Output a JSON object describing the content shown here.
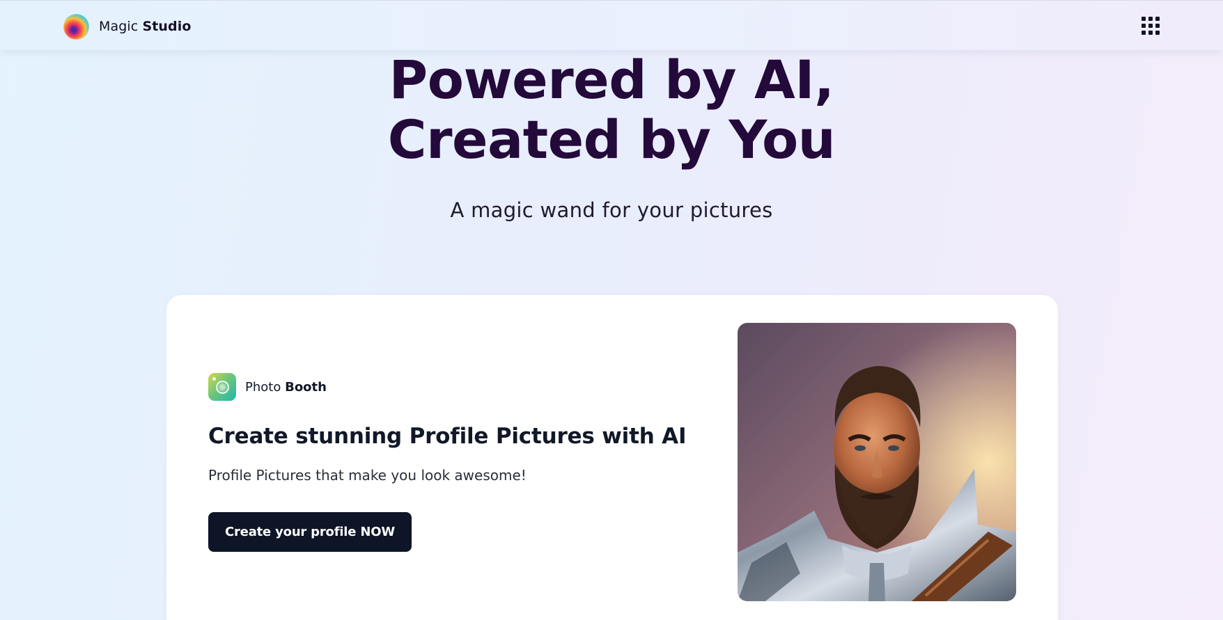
{
  "header": {
    "brand_light": "Magic",
    "brand_bold": "Studio",
    "logo_icon": "magic-studio-logo",
    "menu_icon": "apps-grid-icon"
  },
  "hero": {
    "title_line1": "Powered by AI,",
    "title_line2": "Created by You",
    "subtitle": "A magic wand for your pictures"
  },
  "card": {
    "app_icon": "photo-booth-icon",
    "app_name_light": "Photo",
    "app_name_bold": "Booth",
    "title": "Create stunning Profile Pictures with AI",
    "description": "Profile Pictures that make you look awesome!",
    "cta_label": "Create your profile NOW",
    "image_subject": "painted portrait of a bearded man in silver armor"
  },
  "colors": {
    "title": "#24093b",
    "button_bg": "#0d1526",
    "card_bg": "#ffffff"
  }
}
